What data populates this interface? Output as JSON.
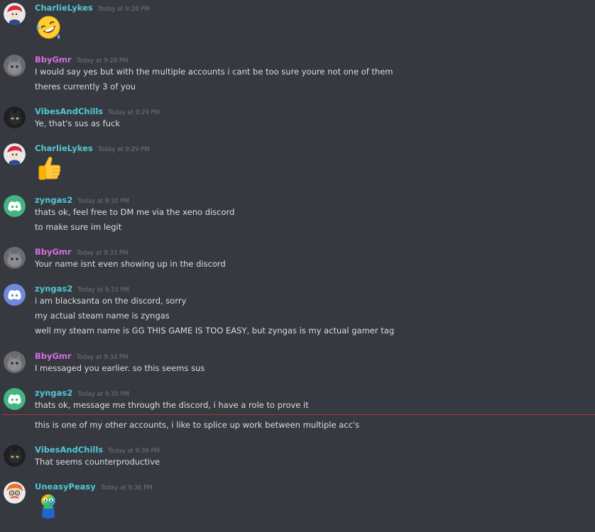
{
  "colors": {
    "background": "#36393f",
    "message_text": "#dcddde",
    "timestamp": "#72767d",
    "new_divider": "#a33a3f",
    "name_teal": "#50c8d6",
    "name_pink": "#d86ee0",
    "name_discord_green": "#43b581",
    "name_discord_blurple": "#7289da"
  },
  "messages": [
    {
      "author": "CharlieLykes",
      "timestamp": "Today at 9:28 PM",
      "content": [
        "🤣"
      ]
    },
    {
      "author": "BbyGmr",
      "timestamp": "Today at 9:28 PM",
      "content": [
        "I would say yes but with the multiple accounts i cant be too sure youre not one of them",
        "theres currently 3 of you"
      ]
    },
    {
      "author": "VibesAndChills",
      "timestamp": "Today at 9:29 PM",
      "content": [
        "Ye, that's sus as fuck"
      ]
    },
    {
      "author": "CharlieLykes",
      "timestamp": "Today at 9:29 PM",
      "content": [
        "👍"
      ]
    },
    {
      "author": "zyngas2",
      "timestamp": "Today at 9:30 PM",
      "content": [
        "thats ok, feel free to DM me via the xeno discord",
        "to make sure im legit"
      ]
    },
    {
      "author": "BbyGmr",
      "timestamp": "Today at 9:33 PM",
      "content": [
        "Your name isnt even showing up in the discord"
      ]
    },
    {
      "author": "zyngas2",
      "timestamp": "Today at 9:33 PM",
      "content": [
        "i am blacksanta on the discord, sorry",
        "my actual steam name is zyngas",
        "well my steam name is GG THIS GAME IS TOO EASY, but zyngas is my actual gamer tag"
      ]
    },
    {
      "author": "BbyGmr",
      "timestamp": "Today at 9:34 PM",
      "content": [
        "I messaged you earlier. so this seems sus"
      ]
    },
    {
      "author": "zyngas2",
      "timestamp": "Today at 9:35 PM",
      "content": [
        "thats ok, message me through the discord, i have a role to prove it",
        "this is one of my other accounts, i like to splice up work between multiple acc's"
      ]
    },
    {
      "author": "VibesAndChills",
      "timestamp": "Today at 9:36 PM",
      "content": [
        "That seems counterproductive"
      ]
    },
    {
      "author": "UneasyPeasy",
      "timestamp": "Today at 9:36 PM",
      "content": [
        "rainbow-pepe-emote"
      ]
    }
  ]
}
